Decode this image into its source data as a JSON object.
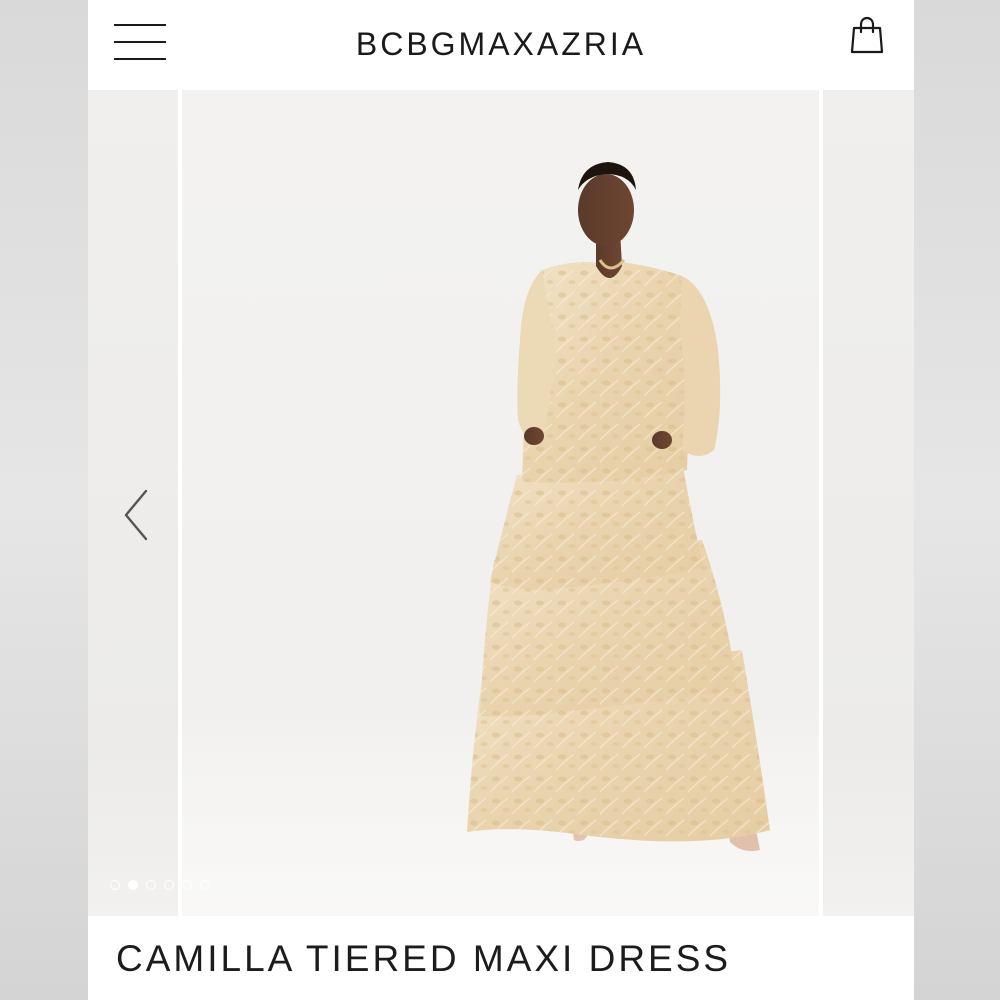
{
  "header": {
    "brand": "BCBGMAXAZRIA",
    "menu_icon": "hamburger-menu-icon",
    "bag_icon": "shopping-bag-icon"
  },
  "carousel": {
    "prev_icon": "chevron-left-icon",
    "slide_count": 6,
    "active_slide": 2
  },
  "product": {
    "title": "CAMILLA TIERED MAXI DRESS"
  },
  "colors": {
    "text": "#1a1a1a",
    "dress": "#ecd9b8",
    "background": "#ffffff"
  }
}
